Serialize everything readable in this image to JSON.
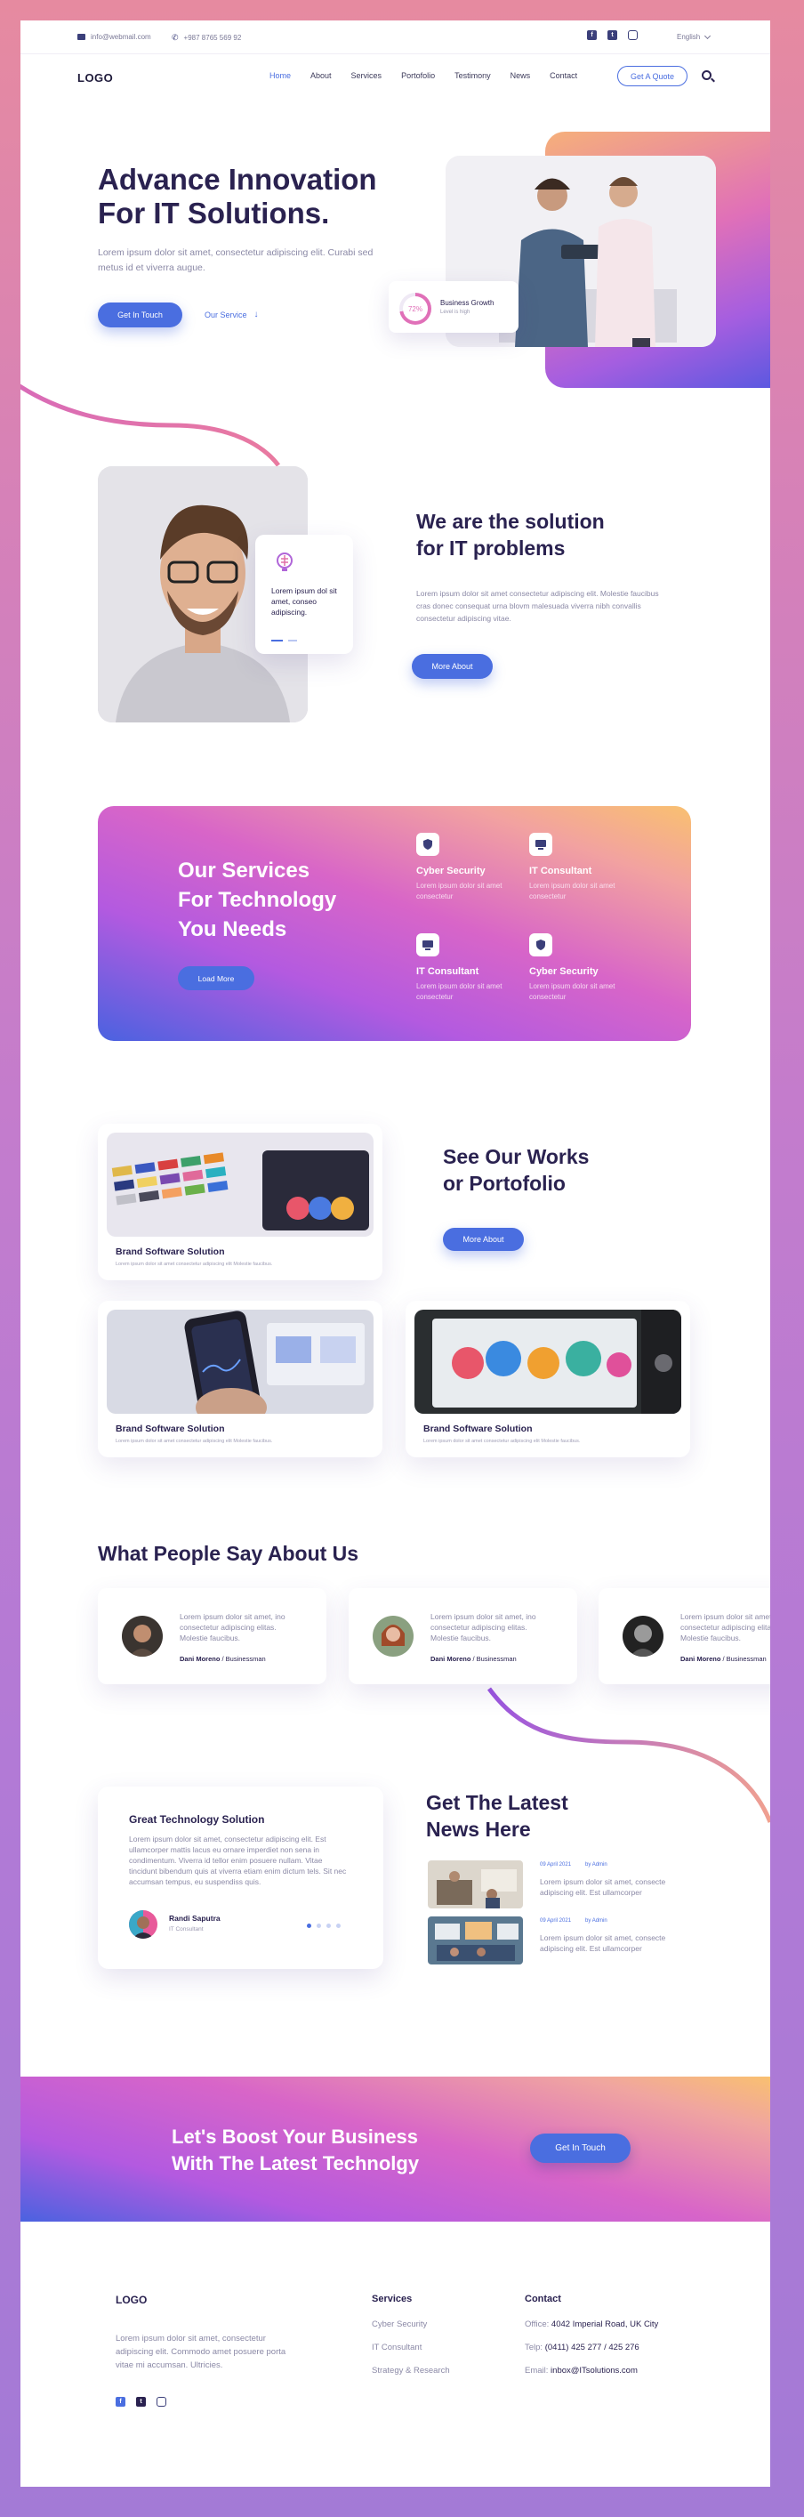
{
  "topbar": {
    "email": "info@webmail.com",
    "phone": "+987 8765 569 92",
    "language": "English",
    "socials": [
      "facebook-icon",
      "twitter-icon",
      "instagram-icon"
    ]
  },
  "header": {
    "logo": "LOGO",
    "nav": [
      "Home",
      "About",
      "Services",
      "Portofolio",
      "Testimony",
      "News",
      "Contact"
    ],
    "active_nav": "Home",
    "quote_button": "Get A Quote"
  },
  "hero": {
    "title_line1": "Advance Innovation",
    "title_line2": "For IT Solutions.",
    "text": "Lorem ipsum dolor sit amet, consectetur adipiscing elit. Curabi sed metus id et viverra augue.",
    "primary_button": "Get In Touch",
    "secondary_link": "Our Service",
    "stat": {
      "percent": "72%",
      "value": 0.72,
      "title": "Business Growth",
      "subtitle": "Level is high"
    }
  },
  "solution": {
    "card_text": "Lorem ipsum dol sit amet, conseo adipiscing.",
    "title_line1": "We are the solution",
    "title_line2": "for IT problems",
    "text": "Lorem ipsum dolor sit amet consectetur adipiscing elit. Molestie faucibus cras donec consequat urna blovm malesuada viverra nibh convallis consectetur adipiscing vitae.",
    "button": "More About"
  },
  "services": {
    "title_line1": "Our Services",
    "title_line2": "For Technology",
    "title_line3": "You Needs",
    "button": "Load More",
    "items": [
      {
        "title": "Cyber Security",
        "text": "Lorem ipsum dolor sit amet consectetur",
        "icon": "shield-icon"
      },
      {
        "title": "IT Consultant",
        "text": "Lorem ipsum dolor sit amet consectetur",
        "icon": "monitor-icon"
      },
      {
        "title": "IT Consultant",
        "text": "Lorem ipsum dolor sit amet consectetur",
        "icon": "monitor-icon"
      },
      {
        "title": "Cyber Security",
        "text": "Lorem ipsum dolor sit amet consectetur",
        "icon": "shield-icon"
      }
    ]
  },
  "works": {
    "title_line1": "See Our Works",
    "title_line2": "or Portofolio",
    "button": "More About",
    "items": [
      {
        "title": "Brand Software Solution",
        "text": "Lorem ipsum dolor sit amet consectetur adipiscing elit Molestie faucibus."
      },
      {
        "title": "Brand Software Solution",
        "text": "Lorem ipsum dolor sit amet consectetur adipiscing elit Molestie faucibus."
      },
      {
        "title": "Brand Software Solution",
        "text": "Lorem ipsum dolor sit amet consectetur adipiscing elit Molestie faucibus."
      }
    ]
  },
  "testimonials": {
    "title": "What People Say About Us",
    "items": [
      {
        "quote": "Lorem ipsum dolor sit amet, ino consectetur adipiscing elitas. Molestie faucibus.",
        "name": "Dani Moreno",
        "role": " / Businessman"
      },
      {
        "quote": "Lorem ipsum dolor sit amet, ino consectetur adipiscing elitas. Molestie faucibus.",
        "name": "Dani Moreno",
        "role": " / Businessman"
      },
      {
        "quote": "Lorem ipsum dolor sit amet, ino consectetur adipiscing elitas. Molestie faucibus.",
        "name": "Dani Moreno",
        "role": " / Businessman"
      }
    ]
  },
  "news": {
    "featured": {
      "title": "Great Technology Solution",
      "text": "Lorem ipsum dolor sit amet, consectetur adipiscing elit. Est ullamcorper mattis lacus eu ornare imperdiet non sena in condimentum. Viverra id tellor enim posuere nullam. Vitae tincidunt bibendum quis at viverra etiam enim dictum tels. Sit nec accumsan tempus, eu suspendiss quis.",
      "author": "Randi Saputra",
      "author_role": "IT Consultant"
    },
    "title_line1": "Get The Latest",
    "title_line2": "News Here",
    "posts": [
      {
        "date": "09 April 2021",
        "author": "by Admin",
        "text": "Lorem ipsum dolor sit amet, consecte adipiscing elit. Est ullamcorper"
      },
      {
        "date": "09 April 2021",
        "author": "by Admin",
        "text": "Lorem ipsum dolor sit amet, consecte adipiscing elit. Est ullamcorper"
      }
    ]
  },
  "cta": {
    "title_line1": "Let's Boost Your Business",
    "title_line2": "With The Latest Technolgy",
    "button": "Get In Touch"
  },
  "footer": {
    "logo": "LOGO",
    "text": "Lorem ipsum dolor sit amet, consectetur adipiscing elit. Commodo amet posuere porta vitae mi accumsan. Ultricies.",
    "services_title": "Services",
    "services_links": [
      "Cyber Security",
      "IT Consultant",
      "Strategy & Research"
    ],
    "contact_title": "Contact",
    "office_label": "Office:",
    "office_value": "4042 Imperial Road, UK City",
    "telp_label": "Telp:",
    "telp_value": "(0411) 425 277 / 425 276",
    "email_label": "Email:",
    "email_value": "inbox@ITsolutions.com"
  },
  "colors": {
    "accent": "#4a6ee0",
    "text": "#2a2250",
    "muted": "#8b89a6",
    "pink": "#d865c8"
  }
}
